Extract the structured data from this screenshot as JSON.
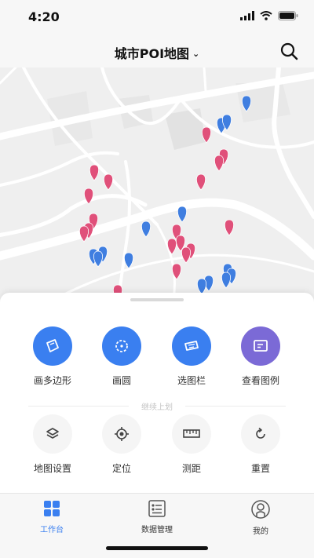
{
  "status_bar": {
    "time": "4:20"
  },
  "header": {
    "title": "城市POI地图"
  },
  "tools_primary": [
    {
      "label": "画多边形",
      "icon": "draw-polygon-icon",
      "color": "#3a7ff0"
    },
    {
      "label": "画圆",
      "icon": "draw-circle-icon",
      "color": "#3a7ff0"
    },
    {
      "label": "选图栏",
      "icon": "select-layer-icon",
      "color": "#3a7ff0"
    },
    {
      "label": "查看图例",
      "icon": "legend-icon",
      "color": "#7b6ad6"
    }
  ],
  "divider_text": "继续上划",
  "tools_secondary": [
    {
      "label": "地图设置",
      "icon": "layers-icon"
    },
    {
      "label": "定位",
      "icon": "locate-icon"
    },
    {
      "label": "测距",
      "icon": "ruler-icon"
    },
    {
      "label": "重置",
      "icon": "reset-icon"
    }
  ],
  "tabs": [
    {
      "label": "工作台",
      "icon": "workbench-icon",
      "active": true
    },
    {
      "label": "数据管理",
      "icon": "data-management-icon",
      "active": false
    },
    {
      "label": "我的",
      "icon": "profile-icon",
      "active": false
    }
  ],
  "colors": {
    "accent": "#3a7ff0",
    "legend": "#7b6ad6",
    "poi_red": "#e0507a",
    "poi_blue": "#3f7ee0"
  }
}
